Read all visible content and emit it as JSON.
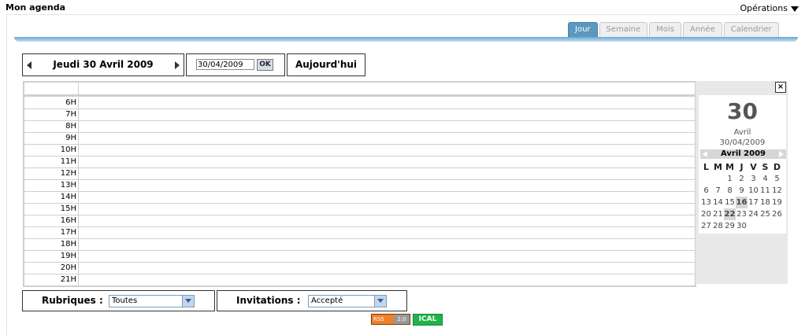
{
  "header": {
    "title": "Mon agenda",
    "operations": "Opérations"
  },
  "tabs": [
    {
      "label": "Jour",
      "active": true
    },
    {
      "label": "Semaine",
      "active": false
    },
    {
      "label": "Mois",
      "active": false
    },
    {
      "label": "Année",
      "active": false
    },
    {
      "label": "Calendrier",
      "active": false
    }
  ],
  "nav": {
    "current_date": "Jeudi 30 Avril 2009",
    "date_input": "30/04/2009",
    "ok_label": "OK",
    "today_label": "Aujourd'hui"
  },
  "hours": [
    "6H",
    "7H",
    "8H",
    "9H",
    "10H",
    "11H",
    "12H",
    "13H",
    "14H",
    "15H",
    "16H",
    "17H",
    "18H",
    "19H",
    "20H",
    "21H"
  ],
  "side_calendar": {
    "close_label": "×",
    "day_number": "30",
    "month_name": "Avril",
    "date_string": "30/04/2009",
    "month_title": "Avril 2009",
    "weekday_headers": [
      "L",
      "M",
      "M",
      "J",
      "V",
      "S",
      "D"
    ],
    "weeks": [
      [
        "",
        "",
        "1",
        "2",
        "3",
        "4",
        "5"
      ],
      [
        "6",
        "7",
        "8",
        "9",
        "10",
        "11",
        "12"
      ],
      [
        "13",
        "14",
        "15",
        "16",
        "17",
        "18",
        "19"
      ],
      [
        "20",
        "21",
        "22",
        "23",
        "24",
        "25",
        "26"
      ],
      [
        "27",
        "28",
        "29",
        "30",
        "",
        "",
        ""
      ]
    ],
    "highlighted_days": [
      "16",
      "22"
    ]
  },
  "filters": {
    "rubriques_label": "Rubriques :",
    "rubriques_value": "Toutes",
    "invitations_label": "Invitations :",
    "invitations_value": "Accepté"
  },
  "badges": {
    "rss_text": "RSS",
    "rss_version": "2.0",
    "ical_text": "ICAL"
  },
  "colors": {
    "active_tab": "#5c97bf",
    "rss": "#f0802a",
    "ical": "#22b24c"
  }
}
